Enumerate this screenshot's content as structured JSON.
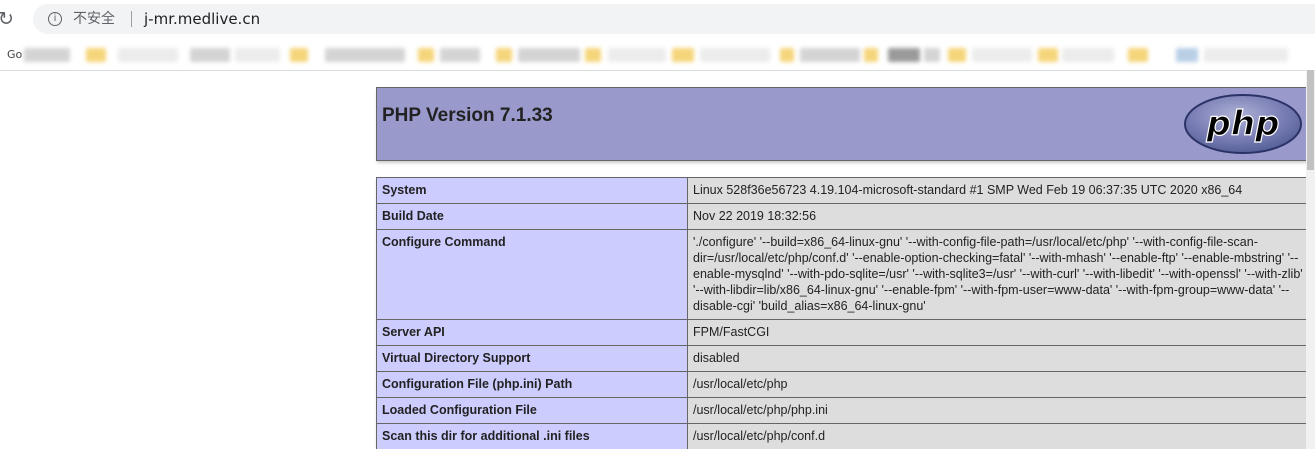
{
  "browser": {
    "security_label": "不安全",
    "url": "j-mr.medlive.cn",
    "bookmarks_first_label": "Go"
  },
  "php": {
    "title": "PHP Version 7.1.33",
    "logo_text": "php"
  },
  "rows": [
    {
      "key": "System",
      "value": "Linux 528f36e56723 4.19.104-microsoft-standard #1 SMP Wed Feb 19 06:37:35 UTC 2020 x86_64"
    },
    {
      "key": "Build Date",
      "value": "Nov 22 2019 18:32:56"
    },
    {
      "key": "Configure Command",
      "value": "'./configure' '--build=x86_64-linux-gnu' '--with-config-file-path=/usr/local/etc/php' '--with-config-file-scan-dir=/usr/local/etc/php/conf.d' '--enable-option-checking=fatal' '--with-mhash' '--enable-ftp' '--enable-mbstring' '--enable-mysqlnd' '--with-pdo-sqlite=/usr' '--with-sqlite3=/usr' '--with-curl' '--with-libedit' '--with-openssl' '--with-zlib' '--with-libdir=lib/x86_64-linux-gnu' '--enable-fpm' '--with-fpm-user=www-data' '--with-fpm-group=www-data' '--disable-cgi' 'build_alias=x86_64-linux-gnu'"
    },
    {
      "key": "Server API",
      "value": "FPM/FastCGI"
    },
    {
      "key": "Virtual Directory Support",
      "value": "disabled"
    },
    {
      "key": "Configuration File (php.ini) Path",
      "value": "/usr/local/etc/php"
    },
    {
      "key": "Loaded Configuration File",
      "value": "/usr/local/etc/php/php.ini"
    },
    {
      "key": "Scan this dir for additional .ini files",
      "value": "/usr/local/etc/php/conf.d"
    },
    {
      "key": "",
      "value": ""
    }
  ],
  "colors": {
    "header_bg": "#9999cc",
    "key_cell_bg": "#ccccff",
    "value_cell_bg": "#dddddd",
    "logo_fill": "#6181b6"
  },
  "icons": {
    "reload": "reload-icon",
    "info": "info-icon",
    "logo": "php-logo"
  }
}
